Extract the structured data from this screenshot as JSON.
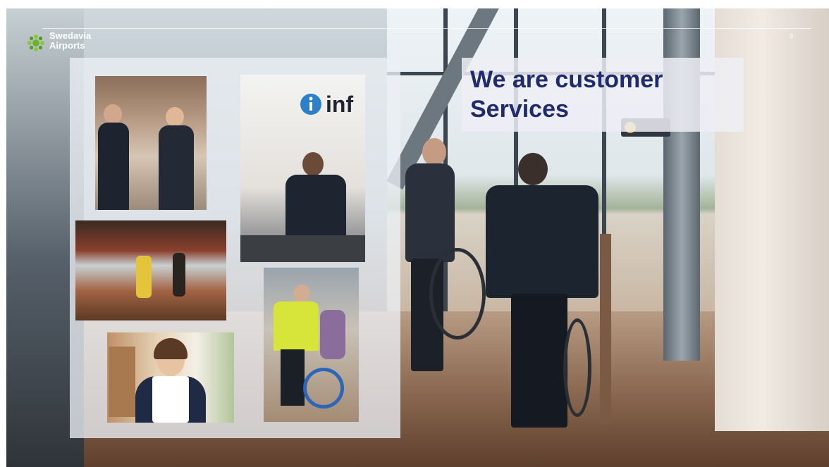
{
  "header": {
    "logo_line1": "Swedavia",
    "logo_line2": "Airports",
    "page_number": "3"
  },
  "title": {
    "line1": "We are customer",
    "line2": "Services"
  },
  "info_sign_text": "inf",
  "colors": {
    "title_text": "#1f2b6c",
    "title_box": "#eeeef6",
    "logo_green": "#6bb32e"
  },
  "icons": [
    "swedavia-logo-icon",
    "info-icon"
  ]
}
